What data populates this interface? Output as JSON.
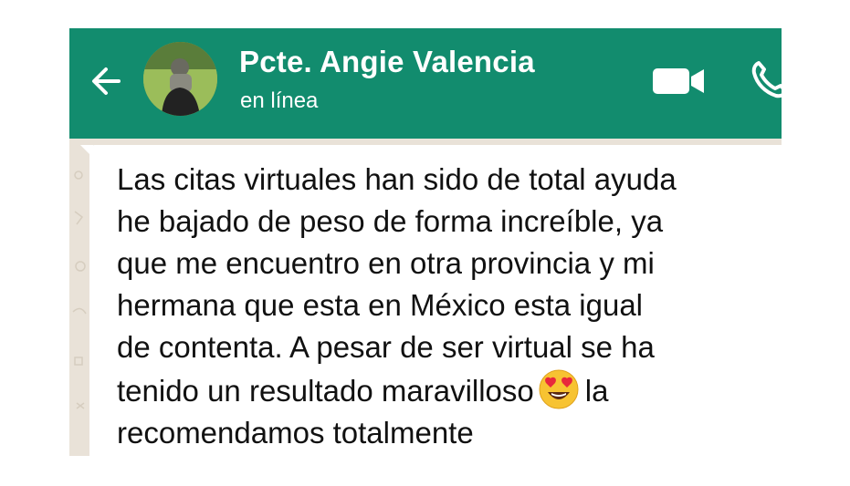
{
  "header": {
    "contact_name": "Pcte. Angie Valencia",
    "status": "en línea",
    "background_color": "#128c6e",
    "icons": [
      "back-arrow-icon",
      "avatar",
      "video-call-icon",
      "phone-icon"
    ]
  },
  "message": {
    "lines": [
      "Las citas virtuales han sido de total ayuda",
      "he bajado de peso de forma increíble, ya",
      "que me encuentro en otra provincia y mi",
      "hermana que esta en México esta igual",
      "de contenta. A pesar de ser virtual se ha",
      "tenido un resultado maravilloso",
      "la",
      "recomendamos totalmente"
    ],
    "emoji": "smiling-face-with-heart-eyes"
  }
}
